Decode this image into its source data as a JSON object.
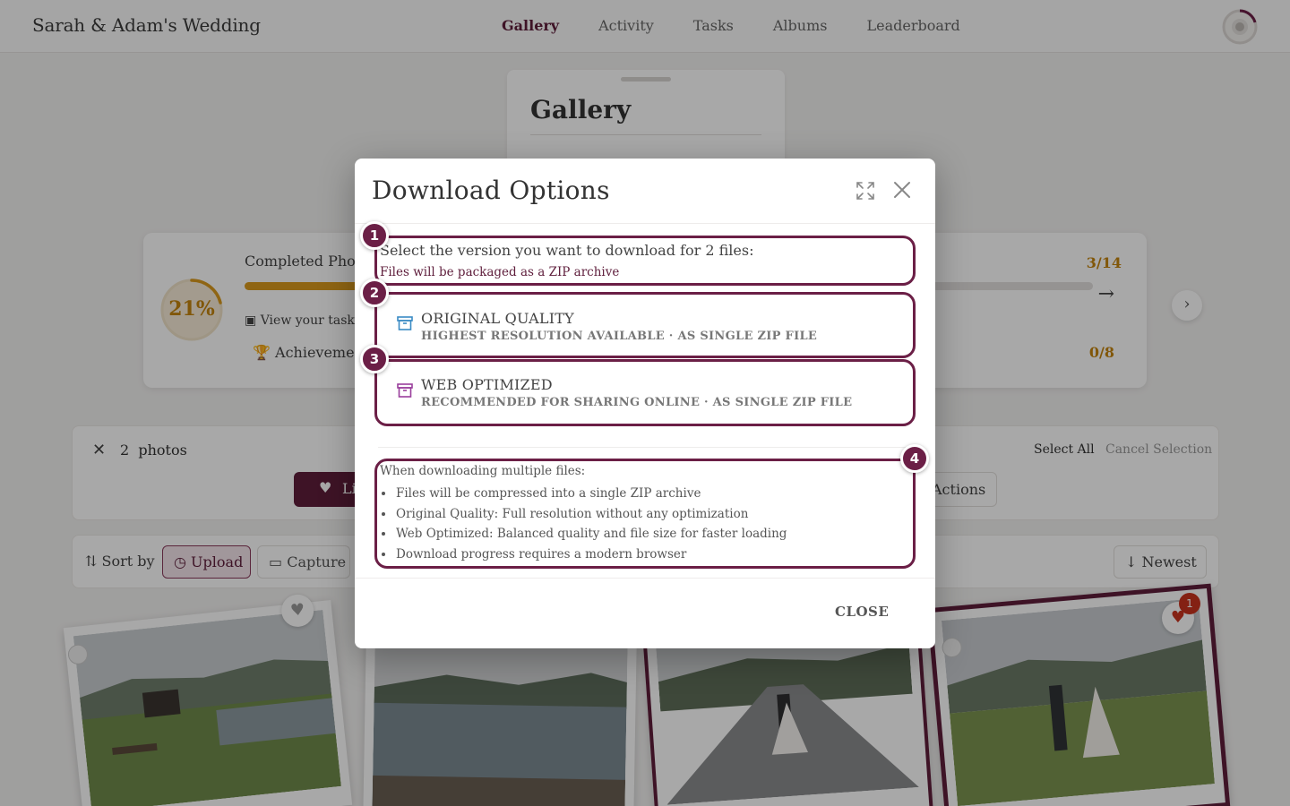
{
  "header": {
    "brand": "Sarah & Adam's Wedding",
    "nav": [
      "Gallery",
      "Activity",
      "Tasks",
      "Albums",
      "Leaderboard"
    ],
    "active_nav": "Gallery"
  },
  "gallery_card": {
    "title": "Gallery"
  },
  "stats": {
    "percent": "21%",
    "completed_title": "Completed Photo",
    "view_task": "View your task p",
    "achievements": "Achievemen",
    "count_top": "3/14",
    "count_bottom": "0/8"
  },
  "selection": {
    "count": "2",
    "count_label": "photos",
    "like_label": "Li",
    "actions_label": "Actions",
    "select_all": "Select All",
    "cancel": "Cancel Selection"
  },
  "sort": {
    "label": "Sort by",
    "upload": "Upload",
    "capture": "Capture",
    "newest": "Newest"
  },
  "photos": {
    "badge_count": "1"
  },
  "modal": {
    "title": "Download Options",
    "intro": "Select the version you want to download for 2 files:",
    "intro_sub": "Files will be packaged as a ZIP archive",
    "options": [
      {
        "title": "ORIGINAL QUALITY",
        "desc": "HIGHEST RESOLUTION AVAILABLE · AS SINGLE ZIP FILE",
        "icon": "archive-icon"
      },
      {
        "title": "WEB OPTIMIZED",
        "desc": "RECOMMENDED FOR SHARING ONLINE · AS SINGLE ZIP FILE",
        "icon": "archive-icon"
      }
    ],
    "info_title": "When downloading multiple files:",
    "info_items": [
      "Files will be compressed into a single ZIP archive",
      "Original Quality: Full resolution without any optimization",
      "Web Optimized: Balanced quality and file size for faster loading",
      "Download progress requires a modern browser"
    ],
    "close": "CLOSE",
    "markers": [
      "1",
      "2",
      "3",
      "4"
    ]
  },
  "colors": {
    "accent": "#5e1d3b",
    "gold": "#c4840f",
    "highlight": "#6b1f46"
  }
}
